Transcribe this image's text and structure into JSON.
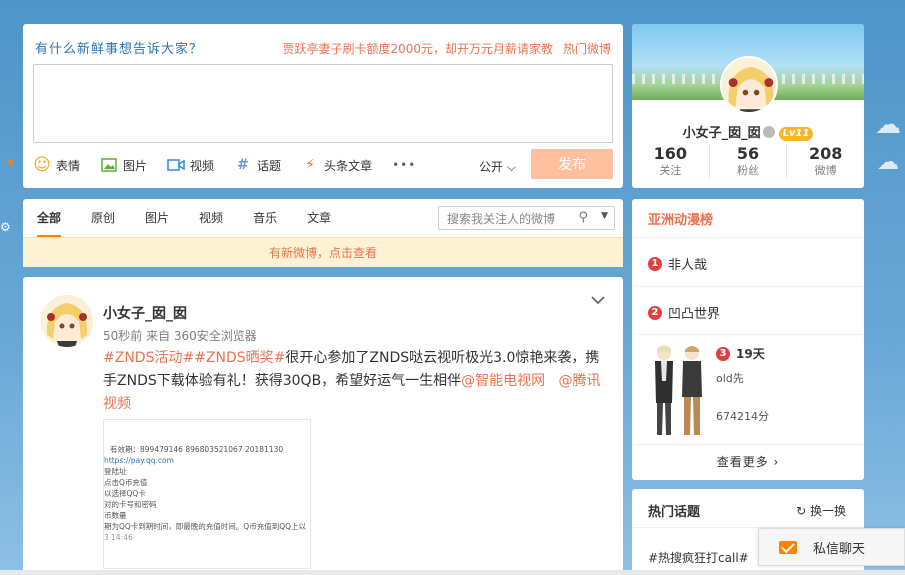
{
  "publish": {
    "title": "有什么新鲜事想告诉大家？",
    "hot_text": "贾跃亭妻子刷卡额度2000元，却开万元月薪请家教",
    "hot_link": "热门微博",
    "tools": [
      {
        "label": "表情",
        "icon": "emoji-icon"
      },
      {
        "label": "图片",
        "icon": "image-icon"
      },
      {
        "label": "视频",
        "icon": "video-icon"
      },
      {
        "label": "话题",
        "icon": "hashtag-icon"
      },
      {
        "label": "头条文章",
        "icon": "lightning-icon"
      }
    ],
    "more": "•••",
    "visibility": "公开",
    "send_label": "发布"
  },
  "tabs": {
    "items": [
      "全部",
      "原创",
      "图片",
      "视频",
      "音乐",
      "文章"
    ],
    "active": "全部",
    "search_placeholder": "搜索我关注人的微博",
    "new_notice": "有新微博，点击查看"
  },
  "post": {
    "author": "小女子_囡_囡",
    "meta": "50秒前 来自 360安全浏览器",
    "topic1": "#ZNDS活动#",
    "topic2": "#ZNDS晒奖#",
    "text1": "很开心参加了ZNDS哒云视听极光3.0惊艳来袭，携手ZNDS下载体验有礼！获得30QB，希望好运气一生相伴",
    "at1": "@智能电视网",
    "at2": "@腾讯视频",
    "image_lines": [
      "有效期：899479146  896803521067   20181130",
      "https://pay.qq.com",
      "登陆址",
      "点击Q币充值",
      "以选择QQ卡",
      "对的卡号和密码",
      "币数量",
      "",
      "期为QQ卡到期时间，即最晚的充值时间。Q币充值到QQ上以",
      "3 14:46"
    ]
  },
  "profile": {
    "name": "小女子_囡_囡",
    "level": "Lv11",
    "stats": [
      {
        "num": "160",
        "label": "关注"
      },
      {
        "num": "56",
        "label": "粉丝"
      },
      {
        "num": "208",
        "label": "微博"
      }
    ]
  },
  "rank": {
    "title": "亚洲动漫榜",
    "items": [
      {
        "n": "1",
        "name": "非人哉"
      },
      {
        "n": "2",
        "name": "凹凸世界"
      }
    ],
    "third": {
      "n": "3",
      "days": "19天",
      "name": "old先",
      "score": "674214分"
    },
    "more": "查看更多 ›"
  },
  "hot_topics": {
    "title": "热门话题",
    "refresh": "换一换",
    "first": "#热搜疯狂打call#"
  },
  "chat": {
    "label": "私信聊天"
  },
  "colors": {
    "accent": "#eb7350",
    "send_disabled": "#ffc09f",
    "link_blue": "#2e74b5"
  }
}
